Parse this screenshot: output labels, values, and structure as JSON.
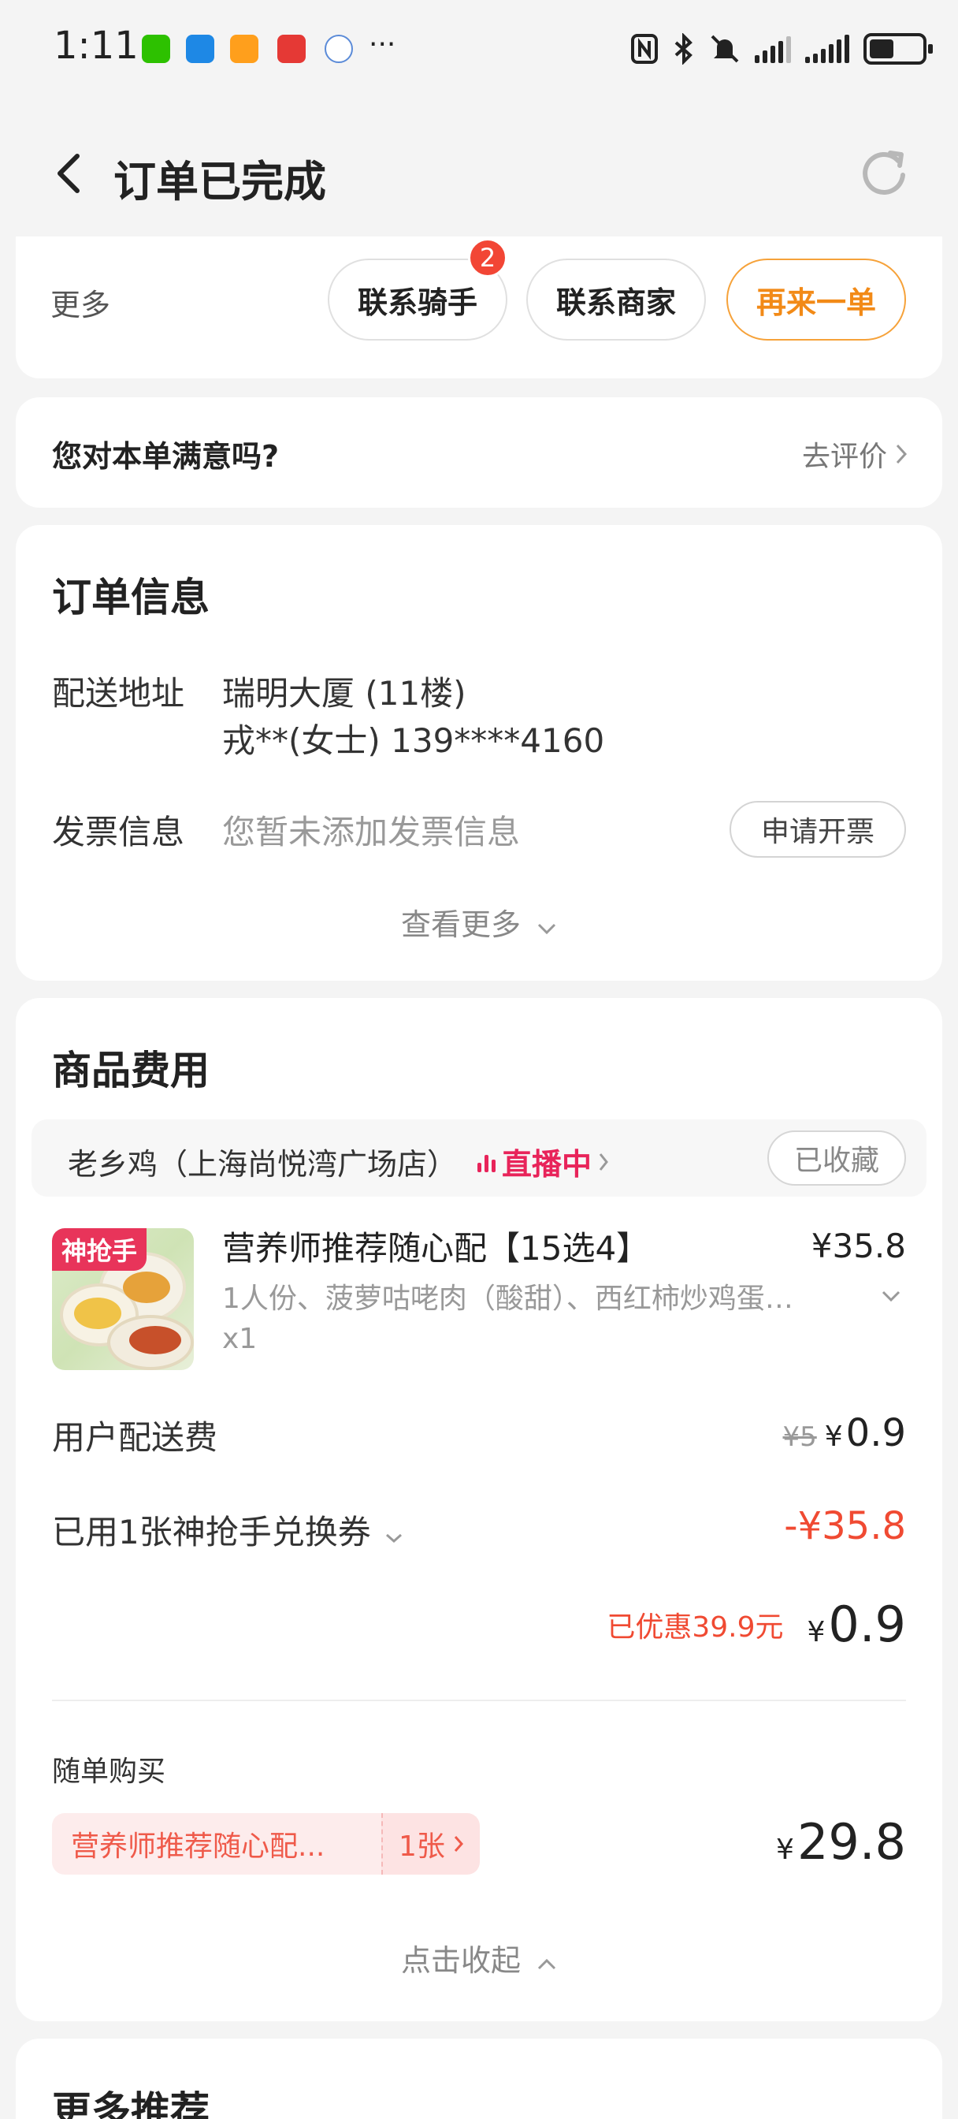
{
  "status_bar": {
    "time": "1:11",
    "more_dots": "···"
  },
  "header": {
    "title": "订单已完成"
  },
  "actions": {
    "more_label": "更多",
    "contact_rider": "联系骑手",
    "rider_badge": "2",
    "contact_merchant": "联系商家",
    "reorder": "再来一单"
  },
  "satisfaction": {
    "question": "您对本单满意吗?",
    "rate_link": "去评价"
  },
  "order_info": {
    "title": "订单信息",
    "address_label": "配送地址",
    "address_line1": "瑞明大厦 (11楼)",
    "address_line2": "戎**(女士) 139****4160",
    "invoice_label": "发票信息",
    "invoice_value": "您暂未添加发票信息",
    "invoice_button": "申请开票",
    "view_more": "查看更多"
  },
  "goods": {
    "title": "商品费用",
    "store_name": "老乡鸡（上海尚悦湾广场店）",
    "live_label": "直播中",
    "favorite_button": "已收藏",
    "product": {
      "tag": "神抢手",
      "name": "营养师推荐随心配【15选4】",
      "price": "¥35.8",
      "description": "1人份、菠萝咕咾肉（酸甜）、西红柿炒鸡蛋…",
      "quantity": "x1"
    },
    "delivery_fee_label": "用户配送费",
    "delivery_fee_original": "¥5",
    "delivery_fee": "0.9",
    "coupon_label": "已用1张神抢手兑换券",
    "coupon_value": "-¥35.8",
    "saved_text": "已优惠39.9元",
    "total": "0.9",
    "addon_label": "随单购买",
    "addon_coupon_name": "营养师推荐随心配...",
    "addon_coupon_count": "1张",
    "addon_price": "29.8",
    "collapse": "点击收起",
    "currency": "¥"
  },
  "recommend": {
    "title": "更多推荐"
  },
  "colors": {
    "accent_orange": "#f28a17",
    "discount_red": "#f04a32",
    "live_pink": "#e8245a"
  }
}
